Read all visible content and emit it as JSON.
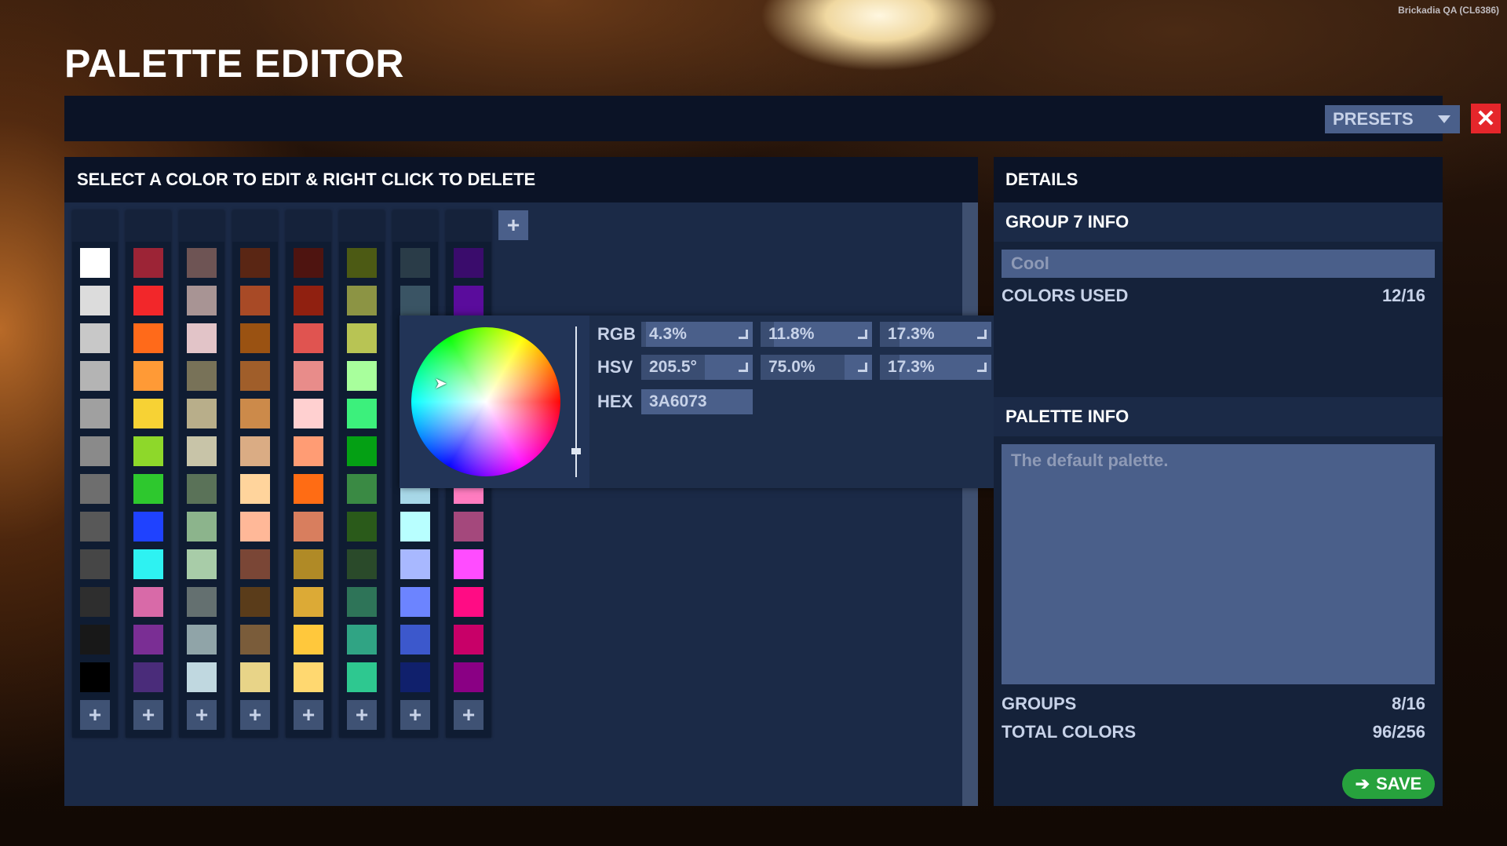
{
  "build_label": "Brickadia QA (CL6386)",
  "title": "PALETTE EDITOR",
  "toolbar": {
    "presets_label": "PRESETS",
    "close_glyph": "✕"
  },
  "left": {
    "header": "SELECT A COLOR TO EDIT & RIGHT CLICK TO DELETE",
    "add_glyph": "+",
    "groups": [
      {
        "colors": [
          "#ffffff",
          "#dcdcdc",
          "#c8c8c8",
          "#b4b4b4",
          "#a0a0a0",
          "#8a8a8a",
          "#6e6e6e",
          "#585858",
          "#464646",
          "#2e2e2e",
          "#181818",
          "#000000"
        ]
      },
      {
        "colors": [
          "#9c2436",
          "#f2272a",
          "#ff6a1a",
          "#ff9a36",
          "#f7d234",
          "#8ed82a",
          "#2ec82e",
          "#1f42ff",
          "#2ef2f2",
          "#d86aa8",
          "#7a2e94",
          "#4a2c7a"
        ]
      },
      {
        "colors": [
          "#6e5454",
          "#a89494",
          "#e2c4c8",
          "#787258",
          "#b8ae8a",
          "#c8c4a8",
          "#5a7258",
          "#8cb48c",
          "#a8cca8",
          "#647070",
          "#90a4a8",
          "#c0d8e0"
        ]
      },
      {
        "colors": [
          "#5a2614",
          "#a84a26",
          "#9a5212",
          "#a05e2a",
          "#cc8a4a",
          "#daac84",
          "#ffd49c",
          "#ffb898",
          "#7a4636",
          "#5a3c1a",
          "#7a5c3a",
          "#e8d488"
        ]
      },
      {
        "colors": [
          "#4e1410",
          "#902010",
          "#e05450",
          "#e88c8a",
          "#ffd0d0",
          "#ff9c74",
          "#ff6c14",
          "#d87e5e",
          "#b08a26",
          "#dcaa36",
          "#ffc83c",
          "#ffd870"
        ]
      },
      {
        "colors": [
          "#4c5a14",
          "#8c9444",
          "#b8c454",
          "#a8ff9c",
          "#3cf07c",
          "#04a014",
          "#3a8a44",
          "#2a5a1a",
          "#2a4a2a",
          "#2e7458",
          "#30a484",
          "#2ec890"
        ]
      },
      {
        "colors": [
          "#2a3c48",
          "#3a5464",
          "#3a6073",
          "#3a6073",
          "#3a6073",
          "#3a6073",
          "#a8d8e8",
          "#b8ffff",
          "#a8b8ff",
          "#6c84ff",
          "#3c58cc",
          "#10206c"
        ]
      },
      {
        "colors": [
          "#3a0c6c",
          "#5a0c9c",
          "#5a0c9c",
          "#5a0c9c",
          "#5a0c9c",
          "#5a0c9c",
          "#ff7cc0",
          "#a4487c",
          "#ff4cff",
          "#ff0c84",
          "#c80068",
          "#8a0084"
        ]
      }
    ]
  },
  "picker": {
    "rgb_label": "RGB",
    "hsv_label": "HSV",
    "hex_label": "HEX",
    "rgb": [
      {
        "text": "4.3%",
        "value": 0.043
      },
      {
        "text": "11.8%",
        "value": 0.118
      },
      {
        "text": "17.3%",
        "value": 0.173
      }
    ],
    "hsv": [
      {
        "text": "205.5°",
        "value": 0.571
      },
      {
        "text": "75.0%",
        "value": 0.75
      },
      {
        "text": "17.3%",
        "value": 0.173
      }
    ],
    "hex": "3A6073",
    "brightness_value": 0.173
  },
  "details": {
    "header": "DETAILS",
    "group_info_title": "GROUP 7 INFO",
    "group_name": "Cool",
    "colors_used_label": "COLORS USED",
    "colors_used_value": "12/16",
    "palette_info_title": "PALETTE INFO",
    "palette_description": "The default palette.",
    "groups_label": "GROUPS",
    "groups_value": "8/16",
    "total_colors_label": "TOTAL COLORS",
    "total_colors_value": "96/256",
    "save_label": "SAVE",
    "save_glyph": "➔"
  }
}
